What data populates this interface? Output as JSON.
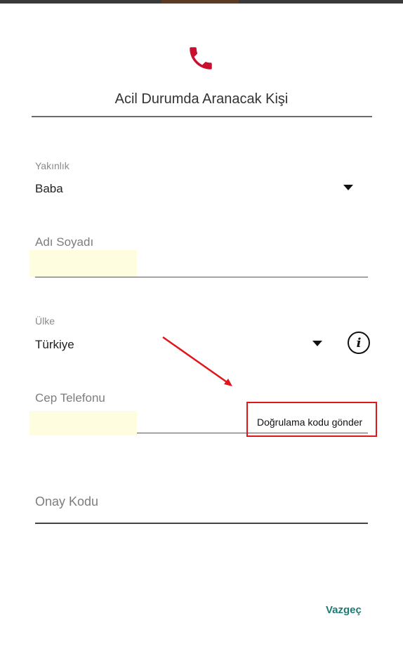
{
  "header": {
    "title": "Acil Durumda Aranacak Kişi"
  },
  "relation": {
    "label": "Yakınlık",
    "value": "Baba"
  },
  "name": {
    "placeholder": "Adı Soyadı"
  },
  "country": {
    "label": "Ülke",
    "value": "Türkiye"
  },
  "phone": {
    "placeholder": "Cep Telefonu",
    "send_code": "Doğrulama kodu gönder"
  },
  "code": {
    "placeholder": "Onay Kodu"
  },
  "actions": {
    "cancel": "Vazgeç"
  },
  "colors": {
    "phone_icon": "#c8102e",
    "highlight": "#e0161b",
    "cancel": "#1f7a74",
    "autofill": "#fffde0"
  },
  "icons": [
    "phone-icon",
    "dropdown-arrow-icon",
    "info-icon",
    "arrow-annotation"
  ]
}
